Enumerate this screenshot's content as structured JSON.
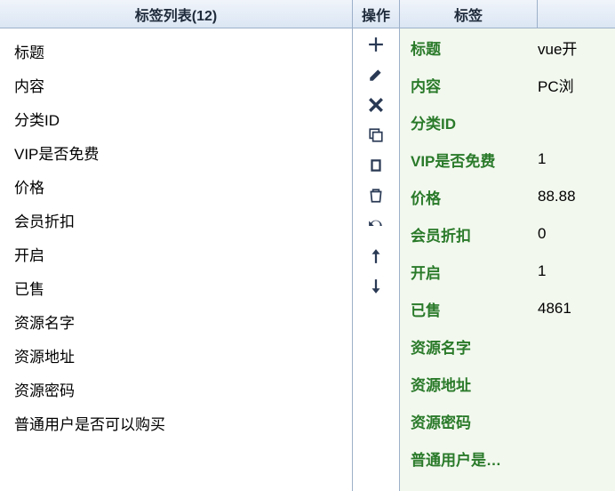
{
  "left": {
    "title": "标签列表(12)",
    "items": [
      "标题",
      "内容",
      "分类ID",
      "VIP是否免费",
      "价格",
      "会员折扣",
      "开启",
      "已售",
      "资源名字",
      "资源地址",
      "资源密码",
      "普通用户是否可以购买"
    ]
  },
  "ops": {
    "title": "操作",
    "icons": {
      "add": "add-icon",
      "edit": "edit-icon",
      "delete": "delete-icon",
      "copy": "copy-icon",
      "paste": "paste-icon",
      "trash": "trash-icon",
      "undo": "undo-icon",
      "moveUp": "arrow-up-icon",
      "moveDown": "arrow-down-icon"
    }
  },
  "right": {
    "labelHeader": "标签",
    "rows": [
      {
        "label": "标题",
        "value": "vue开"
      },
      {
        "label": "内容",
        "value": "PC浏"
      },
      {
        "label": "分类ID",
        "value": ""
      },
      {
        "label": "VIP是否免费",
        "value": "1"
      },
      {
        "label": "价格",
        "value": "88.88"
      },
      {
        "label": "会员折扣",
        "value": "0"
      },
      {
        "label": "开启",
        "value": "1"
      },
      {
        "label": "已售",
        "value": "4861"
      },
      {
        "label": "资源名字",
        "value": ""
      },
      {
        "label": "资源地址",
        "value": ""
      },
      {
        "label": "资源密码",
        "value": ""
      },
      {
        "label": "普通用户是…",
        "value": ""
      }
    ]
  }
}
